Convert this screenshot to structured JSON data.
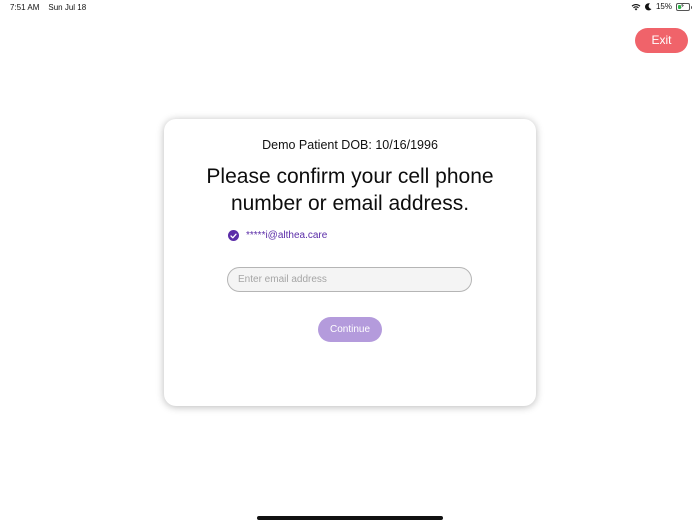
{
  "status_bar": {
    "time": "7:51 AM",
    "date": "Sun Jul 18",
    "battery_percent": "15%",
    "battery_level": 0.15
  },
  "header": {
    "exit_label": "Exit"
  },
  "card": {
    "patient_line": "Demo Patient DOB: 10/16/1996",
    "heading_line1": "Please confirm your cell phone",
    "heading_line2": "number or email address.",
    "contact_option": "*****i@althea.care",
    "email_placeholder": "Enter email address",
    "email_value": "",
    "continue_label": "Continue"
  },
  "colors": {
    "exit_button": "#f0636a",
    "accent_purple": "#5b2da8",
    "continue_button": "#b49bdc"
  },
  "icons": [
    "wifi-icon",
    "moon-icon",
    "battery-icon",
    "check-icon"
  ]
}
